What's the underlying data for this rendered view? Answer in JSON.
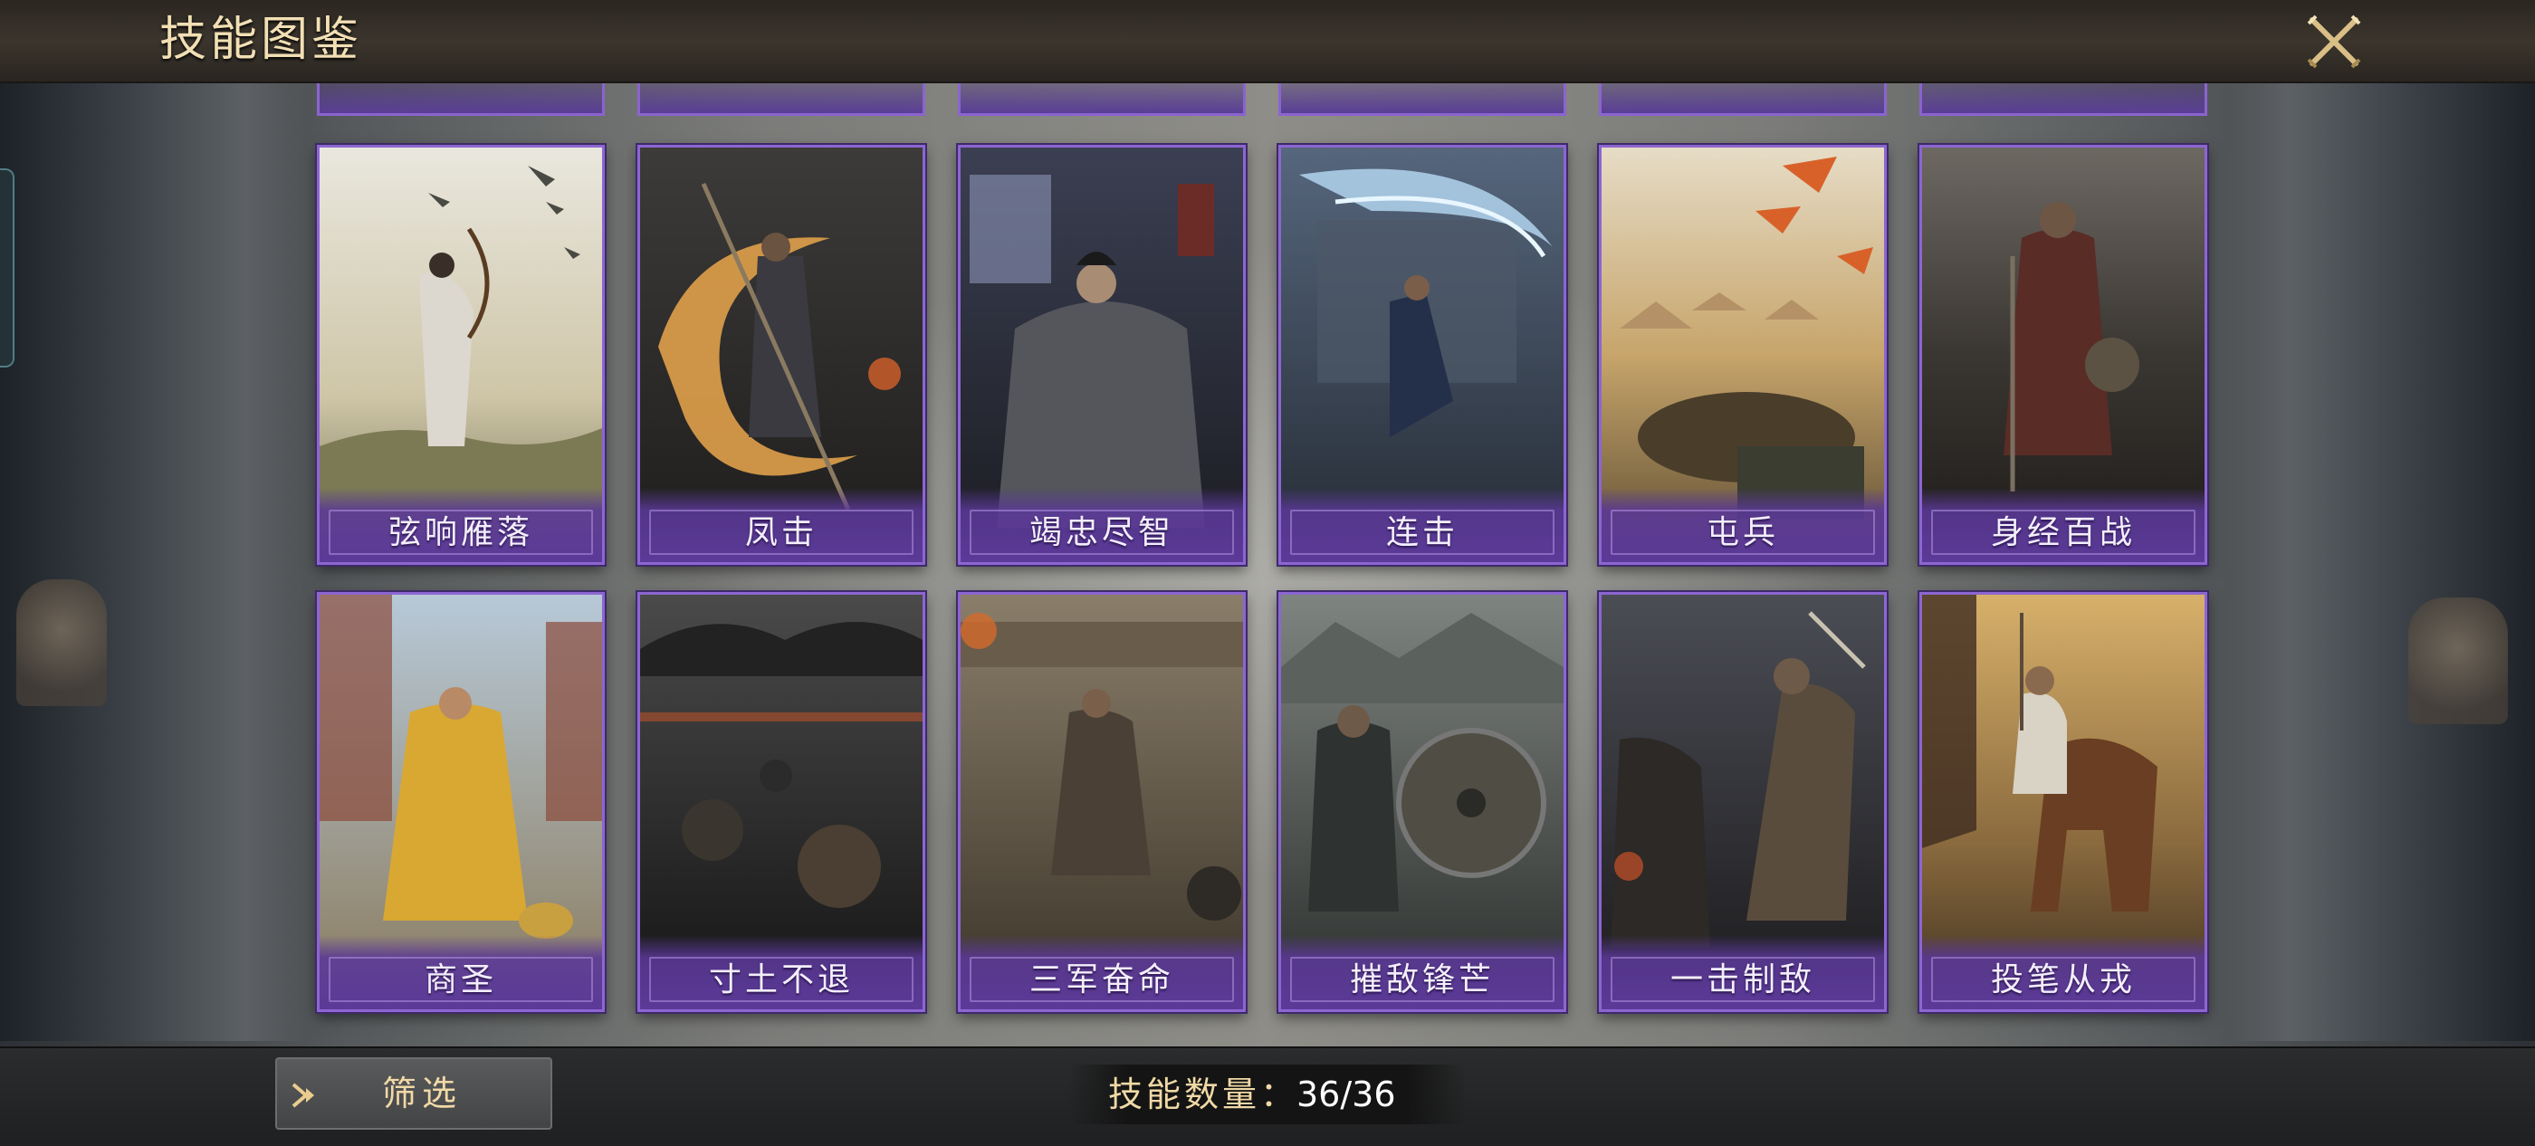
{
  "header": {
    "title": "技能图鉴",
    "close_icon": "crossed-swords-close-icon"
  },
  "skills": [
    {
      "name": "弦响雁落",
      "art": "archer-geese"
    },
    {
      "name": "凤击",
      "art": "warrior-fire-swirl"
    },
    {
      "name": "竭忠尽智",
      "art": "strategist-seated"
    },
    {
      "name": "连击",
      "art": "swordsman-water-slash"
    },
    {
      "name": "屯兵",
      "art": "army-camp"
    },
    {
      "name": "身经百战",
      "art": "veteran-general"
    },
    {
      "name": "商圣",
      "art": "merchant-market"
    },
    {
      "name": "寸土不退",
      "art": "shield-wall-army"
    },
    {
      "name": "三军奋命",
      "art": "charging-soldiers"
    },
    {
      "name": "摧敌锋芒",
      "art": "shield-warrior"
    },
    {
      "name": "一击制敌",
      "art": "duel-strike"
    },
    {
      "name": "投笔从戎",
      "art": "scholar-on-horse"
    }
  ],
  "footer": {
    "filter_label": "筛选",
    "filter_icon": "chevron-right-icon",
    "count_label": "技能数量：",
    "count_value": "36/36"
  },
  "colors": {
    "card_border": "#8d66d1",
    "card_band": "#5b3a98",
    "title_gold": "#f2dfb4",
    "footer_gold": "#f0d9a6"
  }
}
